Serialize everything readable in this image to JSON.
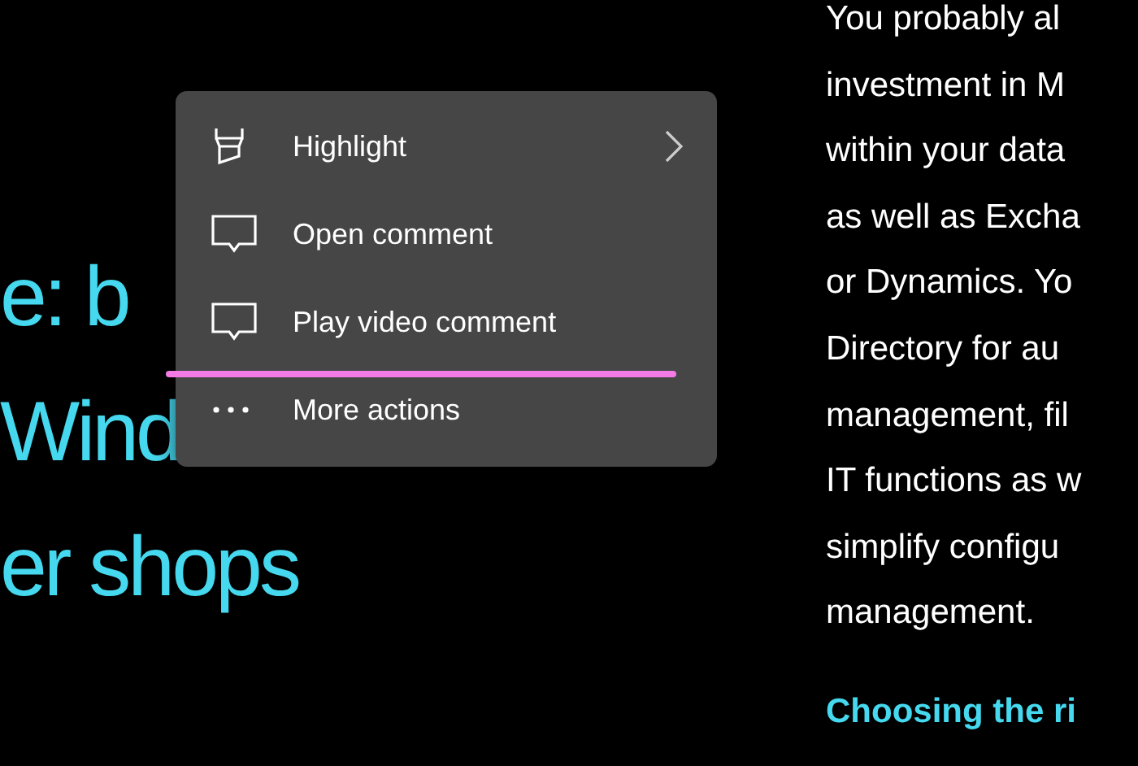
{
  "heading_lines": [
    "e: b",
    "Wind",
    "er shops"
  ],
  "body_lines": [
    "You probably al",
    "investment in M",
    "within your data",
    "as well as Excha",
    "or Dynamics. Yo",
    "Directory for au",
    "management, fil",
    "IT functions as w",
    "simplify configu",
    "management."
  ],
  "subheading": "Choosing the ri",
  "context_menu": {
    "items": [
      {
        "kind": "highlight",
        "label": "Highlight",
        "submenu": true
      },
      {
        "kind": "comment",
        "label": "Open comment",
        "submenu": false
      },
      {
        "kind": "comment",
        "label": "Play video comment",
        "submenu": false
      },
      {
        "kind": "more",
        "label": "More actions",
        "submenu": false
      }
    ]
  }
}
